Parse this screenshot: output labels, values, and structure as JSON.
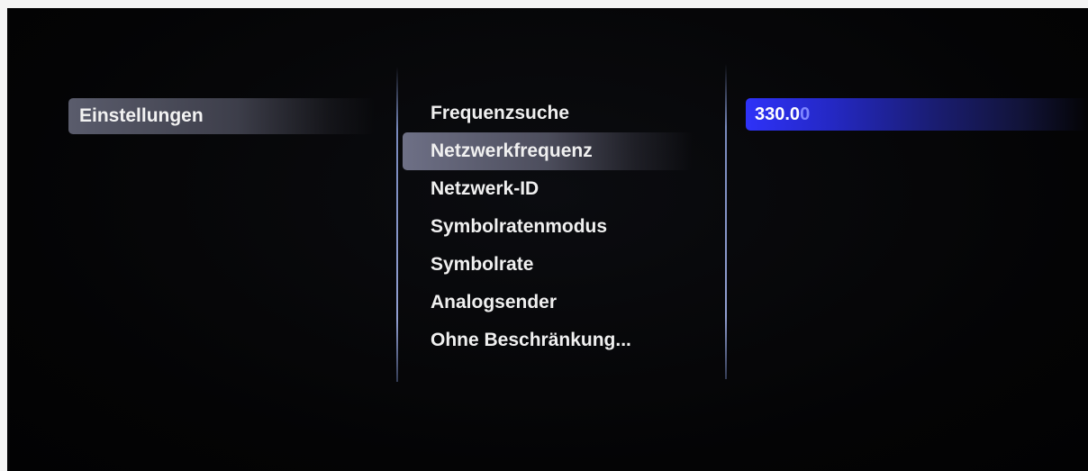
{
  "breadcrumb": {
    "label": "Einstellungen"
  },
  "menu": {
    "items": [
      {
        "label": "Frequenzsuche"
      },
      {
        "label": "Netzwerkfrequenz"
      },
      {
        "label": "Netzwerk-ID"
      },
      {
        "label": "Symbolratenmodus"
      },
      {
        "label": "Symbolrate"
      },
      {
        "label": "Analogsender"
      },
      {
        "label": "Ohne Beschränkung..."
      }
    ],
    "selected_index": 1
  },
  "value": {
    "entered": "330.0",
    "editing_digit": "0"
  },
  "colors": {
    "selection": "#5a5c6c",
    "value_highlight": "#2e32f8",
    "divider": "#9aa8e0",
    "background": "#050506"
  }
}
